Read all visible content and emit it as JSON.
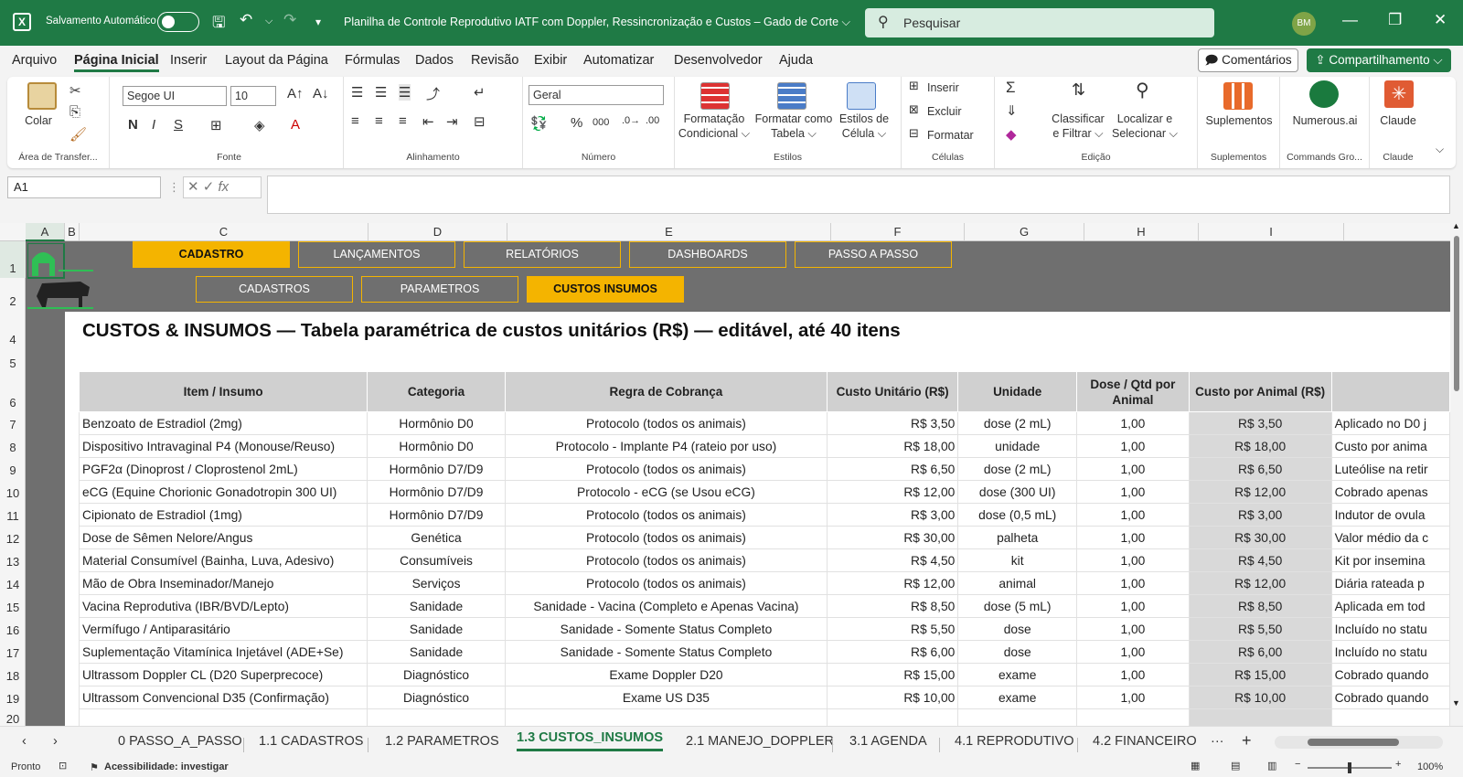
{
  "titlebar": {
    "app_icon": "excel-icon",
    "autosave_label": "Salvamento Automático",
    "doc_title": "Planilha de Controle Reprodutivo IATF com Doppler, Ressincronização e Custos – Gado de Corte ⌵",
    "search_placeholder": "Pesquisar",
    "avatar": "BM"
  },
  "menu": [
    "Arquivo",
    "Página Inicial",
    "Inserir",
    "Layout da Página",
    "Fórmulas",
    "Dados",
    "Revisão",
    "Exibir",
    "Automatizar",
    "Desenvolvedor",
    "Ajuda"
  ],
  "menu_active": "Página Inicial",
  "comments_label": "Comentários",
  "share_label": "Compartilhamento ⌵",
  "ribbon": {
    "clipboard": {
      "paste": "Colar",
      "label": "Área de Transfer..."
    },
    "font": {
      "name": "Segoe UI",
      "size": "10",
      "label": "Fonte",
      "bold": "N",
      "italic": "I",
      "underline": "S"
    },
    "alignment": {
      "label": "Alinhamento"
    },
    "number": {
      "format": "Geral",
      "label": "Número",
      "percent": "%",
      "thousands": "000"
    },
    "styles": {
      "cond": "Formatação Condicional ⌵",
      "table": "Formatar como Tabela ⌵",
      "cell": "Estilos de Célula ⌵",
      "label": "Estilos"
    },
    "cells": {
      "insert": "Inserir",
      "delete": "Excluir",
      "format": "Formatar",
      "label": "Células"
    },
    "editing": {
      "sort": "Classificar e Filtrar ⌵",
      "find": "Localizar e Selecionar ⌵",
      "label": "Edição"
    },
    "addins": {
      "name": "Suplementos",
      "label": "Suplementos"
    },
    "numerous": {
      "name": "Numerous.ai",
      "label": "Commands Gro..."
    },
    "claude": {
      "name": "Claude",
      "label": "Claude"
    }
  },
  "namebox": "A1",
  "columns": [
    "A",
    "B",
    "C",
    "D",
    "E",
    "F",
    "G",
    "H",
    "I"
  ],
  "rows": [
    "1",
    "2",
    "4",
    "5",
    "6",
    "7",
    "8",
    "9",
    "10",
    "11",
    "12",
    "13",
    "14",
    "15",
    "16",
    "17",
    "18",
    "19",
    "20"
  ],
  "nav_top": [
    "CADASTRO",
    "LANÇAMENTOS",
    "RELATÓRIOS",
    "DASHBOARDS",
    "PASSO A PASSO"
  ],
  "nav_sub": [
    "CADASTROS",
    "PARAMETROS",
    "CUSTOS INSUMOS"
  ],
  "heading": "CUSTOS & INSUMOS — Tabela paramétrica de custos unitários (R$) — editável, até 40 itens",
  "table": {
    "headers": [
      "Item / Insumo",
      "Categoria",
      "Regra de Cobrança",
      "Custo Unitário (R$)",
      "Unidade",
      "Dose / Qtd por Animal",
      "Custo por Animal (R$)",
      ""
    ],
    "rows": [
      [
        "Benzoato de Estradiol (2mg)",
        "Hormônio D0",
        "Protocolo (todos os animais)",
        "R$ 3,50",
        "dose (2 mL)",
        "1,00",
        "R$ 3,50",
        "Aplicado no D0 j"
      ],
      [
        "Dispositivo Intravaginal P4 (Monouse/Reuso)",
        "Hormônio D0",
        "Protocolo - Implante P4 (rateio por uso)",
        "R$ 18,00",
        "unidade",
        "1,00",
        "R$ 18,00",
        "Custo por anima"
      ],
      [
        "PGF2α (Dinoprost / Cloprostenol 2mL)",
        "Hormônio D7/D9",
        "Protocolo (todos os animais)",
        "R$ 6,50",
        "dose (2 mL)",
        "1,00",
        "R$ 6,50",
        "Luteólise na retir"
      ],
      [
        "eCG (Equine Chorionic Gonadotropin 300 UI)",
        "Hormônio D7/D9",
        "Protocolo - eCG (se Usou eCG)",
        "R$ 12,00",
        "dose (300 UI)",
        "1,00",
        "R$ 12,00",
        "Cobrado apenas"
      ],
      [
        "Cipionato de Estradiol (1mg)",
        "Hormônio D7/D9",
        "Protocolo (todos os animais)",
        "R$ 3,00",
        "dose (0,5 mL)",
        "1,00",
        "R$ 3,00",
        "Indutor de ovula"
      ],
      [
        "Dose de Sêmen Nelore/Angus",
        "Genética",
        "Protocolo (todos os animais)",
        "R$ 30,00",
        "palheta",
        "1,00",
        "R$ 30,00",
        "Valor médio da c"
      ],
      [
        "Material Consumível (Bainha, Luva, Adesivo)",
        "Consumíveis",
        "Protocolo (todos os animais)",
        "R$ 4,50",
        "kit",
        "1,00",
        "R$ 4,50",
        "Kit por insemina"
      ],
      [
        "Mão de Obra Inseminador/Manejo",
        "Serviços",
        "Protocolo (todos os animais)",
        "R$ 12,00",
        "animal",
        "1,00",
        "R$ 12,00",
        "Diária rateada p"
      ],
      [
        "Vacina Reprodutiva (IBR/BVD/Lepto)",
        "Sanidade",
        "Sanidade - Vacina (Completo e Apenas Vacina)",
        "R$ 8,50",
        "dose (5 mL)",
        "1,00",
        "R$ 8,50",
        "Aplicada em tod"
      ],
      [
        "Vermífugo / Antiparasitário",
        "Sanidade",
        "Sanidade - Somente Status Completo",
        "R$ 5,50",
        "dose",
        "1,00",
        "R$ 5,50",
        "Incluído no statu"
      ],
      [
        "Suplementação Vitamínica Injetável (ADE+Se)",
        "Sanidade",
        "Sanidade - Somente Status Completo",
        "R$ 6,00",
        "dose",
        "1,00",
        "R$ 6,00",
        "Incluído no statu"
      ],
      [
        "Ultrassom Doppler CL (D20 Superprecoce)",
        "Diagnóstico",
        "Exame Doppler D20",
        "R$ 15,00",
        "exame",
        "1,00",
        "R$ 15,00",
        "Cobrado quando"
      ],
      [
        "Ultrassom Convencional D35 (Confirmação)",
        "Diagnóstico",
        "Exame US D35",
        "R$ 10,00",
        "exame",
        "1,00",
        "R$ 10,00",
        "Cobrado quando"
      ]
    ]
  },
  "sheet_tabs": [
    "0 PASSO_A_PASSO",
    "1.1 CADASTROS",
    "1.2 PARAMETROS",
    "1.3 CUSTOS_INSUMOS",
    "2.1 MANEJO_DOPPLER",
    "3.1 AGENDA",
    "4.1 REPRODUTIVO",
    "4.2 FINANCEIRO"
  ],
  "active_tab": "1.3 CUSTOS_INSUMOS",
  "status": {
    "ready": "Pronto",
    "accessibility": "Acessibilidade: investigar",
    "zoom": "100%"
  },
  "colors": {
    "excel_green": "#1f7a45",
    "nav_gold": "#f4b400",
    "banner_gray": "#6f6f6f"
  }
}
